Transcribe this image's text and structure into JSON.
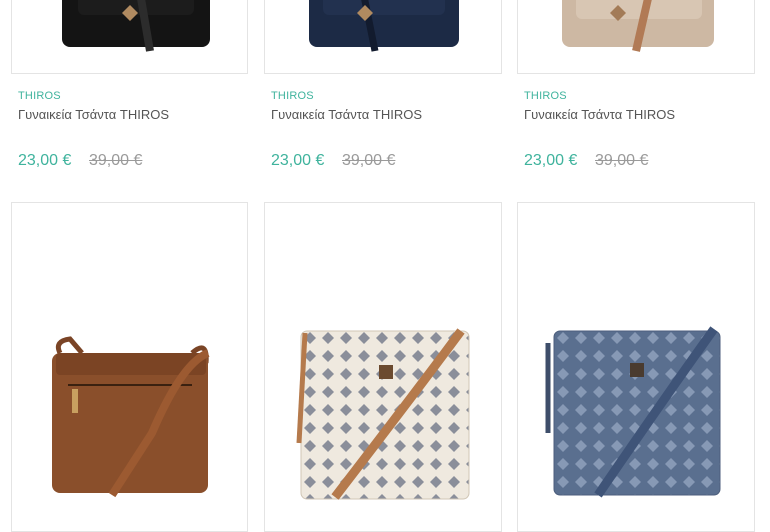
{
  "products": [
    {
      "brand": "THIROS",
      "title": "Γυναικεία Τσάντα THIROS",
      "price": "23,00 €",
      "old_price": "39,00 €",
      "color": "#141414"
    },
    {
      "brand": "THIROS",
      "title": "Γυναικεία Τσάντα THIROS",
      "price": "23,00 €",
      "old_price": "39,00 €",
      "color": "#1c2a45"
    },
    {
      "brand": "THIROS",
      "title": "Γυναικεία Τσάντα THIROS",
      "price": "23,00 €",
      "old_price": "39,00 €",
      "color": "#cdb8a3"
    },
    {
      "color": "#8a4f2b"
    },
    {
      "color": "#efe9df"
    },
    {
      "color": "#5a6f8f"
    }
  ],
  "theme": {
    "accent": "#3fb39d",
    "old_price": "#9a9a9a",
    "text": "#555555",
    "border": "#e4e4e4"
  }
}
